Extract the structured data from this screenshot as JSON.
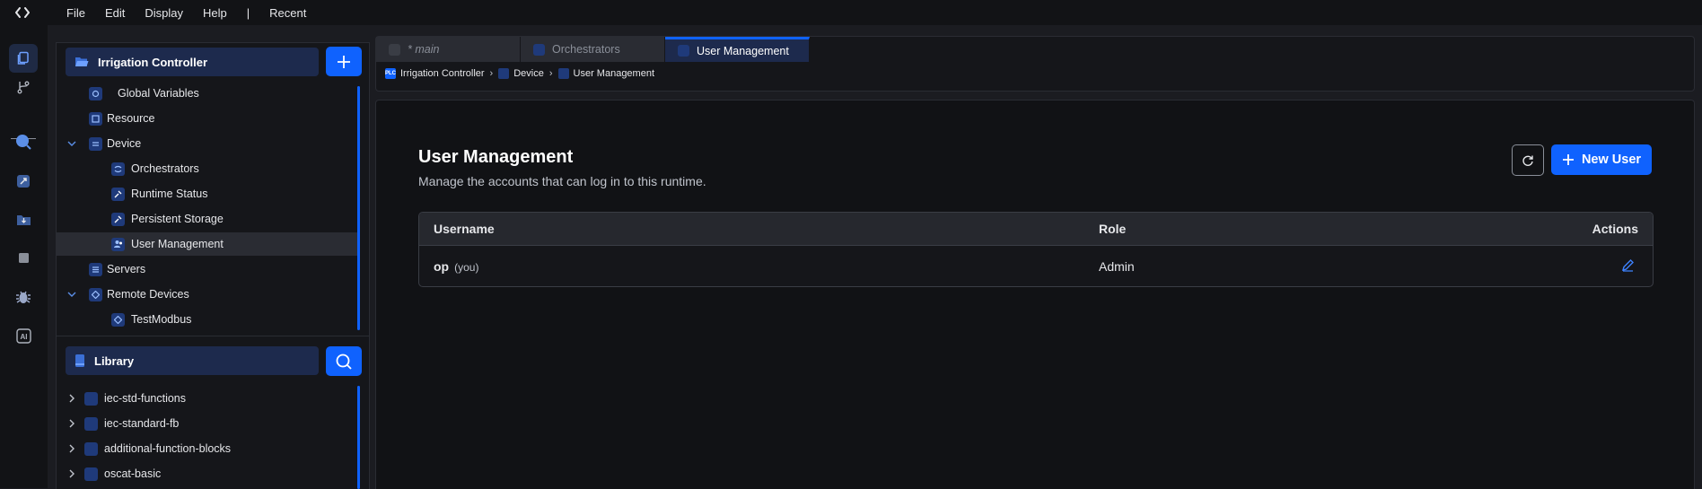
{
  "menu": {
    "items": [
      "File",
      "Edit",
      "Display",
      "Help"
    ],
    "separator": "|",
    "recent": "Recent"
  },
  "colors": {
    "accent": "#0f62fe",
    "selected_bg": "#1d2a4d",
    "panel_bg": "#15161a"
  },
  "project": {
    "header": "Irrigation Controller",
    "add_icon": "plus-icon",
    "tree": [
      {
        "label": "Global Variables",
        "icon": "globe-variable-icon"
      },
      {
        "label": "Resource",
        "icon": "resource-icon"
      },
      {
        "label": "Device",
        "icon": "device-icon",
        "expanded": true
      },
      {
        "label": "Orchestrators",
        "icon": "orchestrator-icon"
      },
      {
        "label": "Runtime Status",
        "icon": "wrench-icon"
      },
      {
        "label": "Persistent Storage",
        "icon": "wrench-icon"
      },
      {
        "label": "User Management",
        "icon": "users-icon",
        "selected": true
      },
      {
        "label": "Servers",
        "icon": "servers-icon"
      },
      {
        "label": "Remote Devices",
        "icon": "network-icon",
        "expanded": true
      },
      {
        "label": "TestModbus",
        "icon": "network-icon"
      }
    ]
  },
  "library": {
    "header": "Library",
    "search_icon": "search-icon",
    "items": [
      "iec-std-functions",
      "iec-standard-fb",
      "additional-function-blocks",
      "oscat-basic"
    ]
  },
  "tabs": [
    {
      "label": "* main",
      "active": false
    },
    {
      "label": "Orchestrators",
      "active": false
    },
    {
      "label": "User Management",
      "active": true
    }
  ],
  "breadcrumb": {
    "root_badge": "PLC",
    "items": [
      "Irrigation Controller",
      "Device",
      "User Management"
    ]
  },
  "page": {
    "title": "User Management",
    "subtitle": "Manage the accounts that can log in to this runtime.",
    "new_user_label": "New User"
  },
  "table": {
    "headers": [
      "Username",
      "Role",
      "Actions"
    ],
    "rows": [
      {
        "username": "op",
        "you_tag": "(you)",
        "role": "Admin"
      }
    ]
  }
}
